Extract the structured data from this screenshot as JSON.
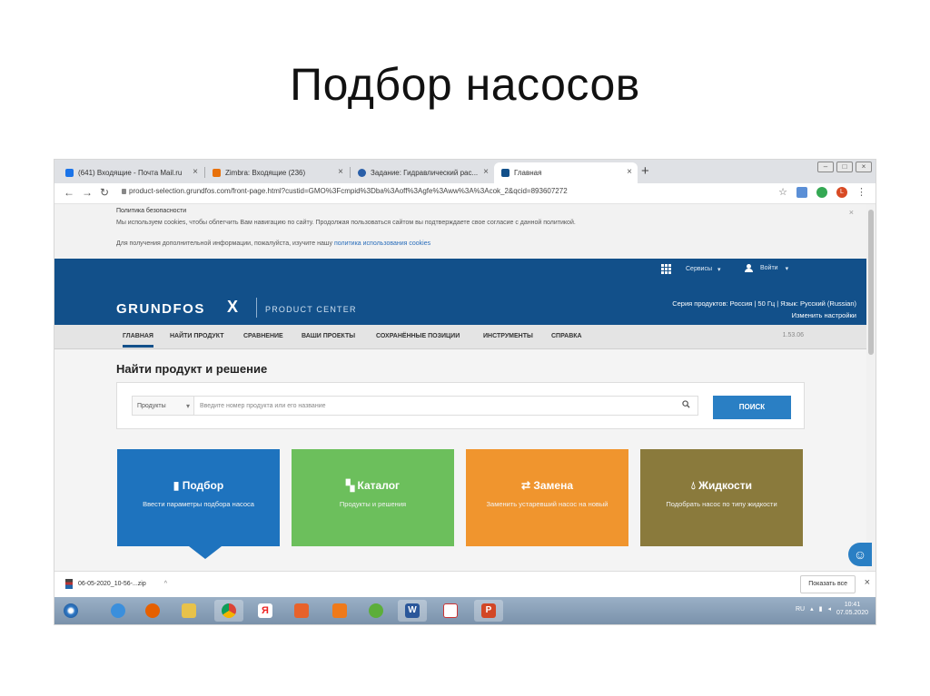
{
  "slide": {
    "title": "Подбор насосов"
  },
  "browser": {
    "tabs": [
      {
        "label": "(641) Входящие - Почта Mail.ru",
        "color": "#1a73e8",
        "active": false
      },
      {
        "label": "Zimbra: Входящие (236)",
        "color": "#e8710a",
        "active": false
      },
      {
        "label": "Задание: Гидравлический рас...",
        "color": "#2a5fa8",
        "active": false
      },
      {
        "label": "Главная",
        "color": "#12508a",
        "active": true
      }
    ],
    "new_tab": "+",
    "url": "product-selection.grundfos.com/front-page.html?custid=GMO%3Fcmpid%3Dba%3Aoff%3Agfe%3Aww%3A%3Acok_2&qcid=893607272",
    "avatar_letter": "L"
  },
  "cookie": {
    "title": "Политика безопасности",
    "text": "Мы используем cookies, чтобы облегчить Вам навигацию по сайту. Продолжая пользоваться сайтом вы подтверждаете свое согласие с данной политикой.",
    "more_prefix": "Для получения дополнительной информации, пожалуйста, изучите нашу",
    "more_link": "политика использования cookies",
    "close": "×"
  },
  "header": {
    "services": "Сервисы",
    "login": "Войти",
    "brand": "GRUNDFOS",
    "brand_mark": "X",
    "product_center": "PRODUCT CENTER",
    "series": "Серия продуктов: Россия | 50 Гц | Язык: Русский (Russian)",
    "settings": "Изменить настройки"
  },
  "menu": {
    "items": [
      "ГЛАВНАЯ",
      "НАЙТИ ПРОДУКТ",
      "СРАВНЕНИЕ",
      "ВАШИ ПРОЕКТЫ",
      "СОХРАНЁННЫЕ ПОЗИЦИИ",
      "ИНСТРУМЕНТЫ",
      "СПРАВКА"
    ],
    "version": "1.53.06"
  },
  "search": {
    "title": "Найти продукт и решение",
    "category": "Продукты",
    "placeholder": "Введите номер продукта или его название",
    "button": "ПОИСК"
  },
  "cards": [
    {
      "title": "Подбор",
      "subtitle": "Ввести параметры подбора насоса",
      "color": "#1e73be",
      "icon": "sizing-icon"
    },
    {
      "title": "Каталог",
      "subtitle": "Продукты и решения",
      "color": "#6cbf5c",
      "icon": "book-icon"
    },
    {
      "title": "Замена",
      "subtitle": "Заменить устаревший насос на новый",
      "color": "#f0952e",
      "icon": "swap-icon"
    },
    {
      "title": "Жидкости",
      "subtitle": "Подобрать насос по типу жидкости",
      "color": "#8a7a3c",
      "icon": "drop-icon"
    }
  ],
  "download": {
    "file": "06-05-2020_10-56-...zip",
    "show_all": "Показать все",
    "close": "×"
  },
  "taskbar": {
    "lang": "RU",
    "time": "10:41",
    "date": "07.05.2020"
  }
}
